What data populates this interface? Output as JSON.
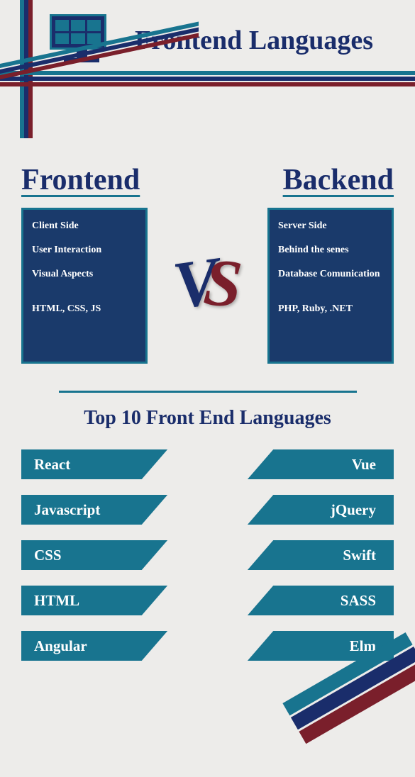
{
  "header": {
    "title": "Frontend Languages"
  },
  "comparison": {
    "frontend": {
      "title": "Frontend",
      "items": [
        "Client Side",
        "User Interaction",
        "Visual Aspects"
      ],
      "tech": "HTML, CSS, JS"
    },
    "backend": {
      "title": "Backend",
      "items": [
        "Server Side",
        "Behind the senes",
        "Database Comunication"
      ],
      "tech": "PHP, Ruby, .NET"
    },
    "vs": {
      "v": "V",
      "s": "S"
    }
  },
  "top10": {
    "title": "Top 10 Front End Languages",
    "left": [
      "React",
      "Javascript",
      "CSS",
      "HTML",
      "Angular"
    ],
    "right": [
      "Vue",
      "jQuery",
      "Swift",
      "SASS",
      "Elm"
    ]
  },
  "colors": {
    "navy": "#1a2d6b",
    "teal": "#18748f",
    "maroon": "#7a1f2b"
  }
}
